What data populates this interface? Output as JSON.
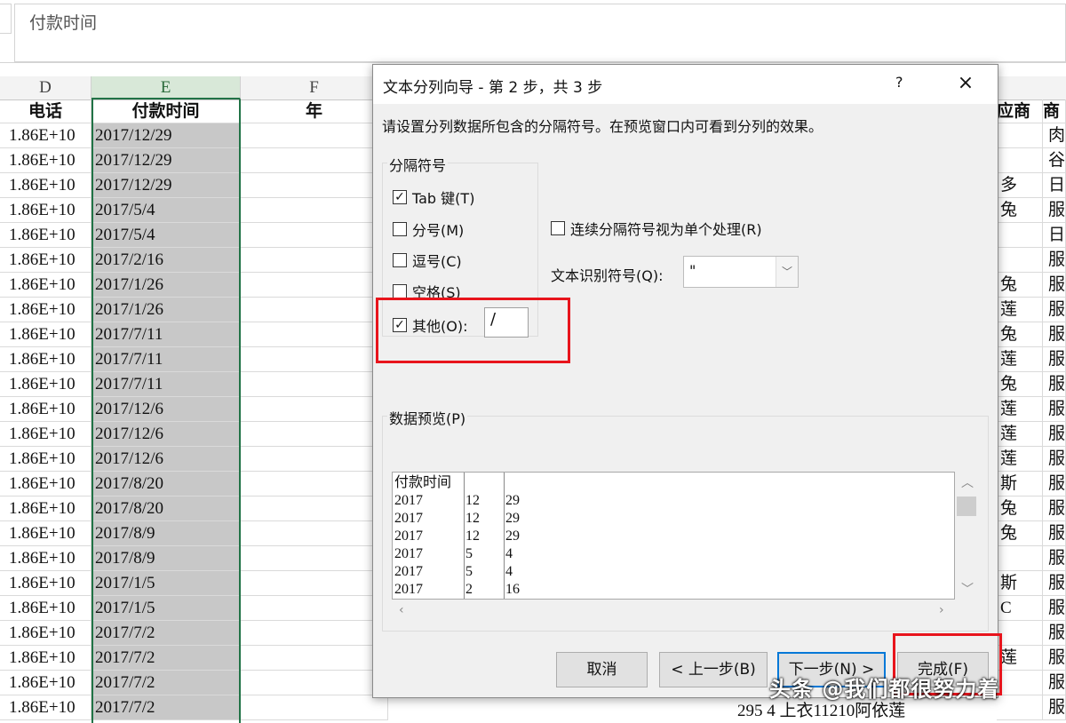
{
  "formula_bar": {
    "value": "付款时间"
  },
  "columns": [
    {
      "letter": "D",
      "header": "电话",
      "selected": false
    },
    {
      "letter": "E",
      "header": "付款时间",
      "selected": true
    },
    {
      "letter": "F",
      "header": "年",
      "selected": false
    }
  ],
  "rows": [
    {
      "phone": "1.86E+10",
      "date": "2017/12/29",
      "right1": "",
      "right2": "肉"
    },
    {
      "phone": "1.86E+10",
      "date": "2017/12/29",
      "right1": "",
      "right2": "谷"
    },
    {
      "phone": "1.86E+10",
      "date": "2017/12/29",
      "right1": "多",
      "right2": "日"
    },
    {
      "phone": "1.86E+10",
      "date": "2017/5/4",
      "right1": "兔",
      "right2": "服"
    },
    {
      "phone": "1.86E+10",
      "date": "2017/5/4",
      "right1": "",
      "right2": "日"
    },
    {
      "phone": "1.86E+10",
      "date": "2017/2/16",
      "right1": "",
      "right2": "服"
    },
    {
      "phone": "1.86E+10",
      "date": "2017/1/26",
      "right1": "兔",
      "right2": "服"
    },
    {
      "phone": "1.86E+10",
      "date": "2017/1/26",
      "right1": "莲",
      "right2": "服"
    },
    {
      "phone": "1.86E+10",
      "date": "2017/7/11",
      "right1": "兔",
      "right2": "服"
    },
    {
      "phone": "1.86E+10",
      "date": "2017/7/11",
      "right1": "莲",
      "right2": "服"
    },
    {
      "phone": "1.86E+10",
      "date": "2017/7/11",
      "right1": "兔",
      "right2": "服"
    },
    {
      "phone": "1.86E+10",
      "date": "2017/12/6",
      "right1": "莲",
      "right2": "服"
    },
    {
      "phone": "1.86E+10",
      "date": "2017/12/6",
      "right1": "莲",
      "right2": "服"
    },
    {
      "phone": "1.86E+10",
      "date": "2017/12/6",
      "right1": "莲",
      "right2": "服"
    },
    {
      "phone": "1.86E+10",
      "date": "2017/8/20",
      "right1": "斯",
      "right2": "服"
    },
    {
      "phone": "1.86E+10",
      "date": "2017/8/20",
      "right1": "兔",
      "right2": "服"
    },
    {
      "phone": "1.86E+10",
      "date": "2017/8/9",
      "right1": "兔",
      "right2": "服"
    },
    {
      "phone": "1.86E+10",
      "date": "2017/8/9",
      "right1": "",
      "right2": "服"
    },
    {
      "phone": "1.86E+10",
      "date": "2017/1/5",
      "right1": "斯",
      "right2": "服"
    },
    {
      "phone": "1.86E+10",
      "date": "2017/1/5",
      "right1": "C",
      "right2": "服"
    },
    {
      "phone": "1.86E+10",
      "date": "2017/7/2",
      "right1": "",
      "right2": "服"
    },
    {
      "phone": "1.86E+10",
      "date": "2017/7/2",
      "right1": "莲",
      "right2": "服"
    },
    {
      "phone": "1.86E+10",
      "date": "2017/7/2",
      "right1": "",
      "right2": "服"
    },
    {
      "phone": "1.86E+10",
      "date": "2017/7/2",
      "right1": "",
      "right2": "服"
    }
  ],
  "right_headers": {
    "h1": "应商",
    "h2": "商"
  },
  "bottom_row_partial": "295    4 上衣11210阿依莲",
  "dialog": {
    "title": "文本分列向导 - 第 2 步，共 3 步",
    "help": "?",
    "close": "×",
    "description": "请设置分列数据所包含的分隔符号。在预览窗口内可看到分列的效果。",
    "delimiters_group": "分隔符号",
    "tab": {
      "label": "Tab 键(T)",
      "checked": true
    },
    "semicolon": {
      "label": "分号(M)",
      "checked": false
    },
    "comma": {
      "label": "逗号(C)",
      "checked": false
    },
    "space": {
      "label": "空格(S)",
      "checked": false
    },
    "other": {
      "label": "其他(O):",
      "checked": true,
      "value": "/"
    },
    "consecutive": {
      "label": "连续分隔符号视为单个处理(R)",
      "checked": false
    },
    "qualifier_label": "文本识别符号(Q):",
    "qualifier_value": "\"",
    "preview_label": "数据预览(P)",
    "preview_rows": [
      [
        "付款时间",
        "",
        ""
      ],
      [
        "2017",
        "12",
        "29"
      ],
      [
        "2017",
        "12",
        "29"
      ],
      [
        "2017",
        "12",
        "29"
      ],
      [
        "2017",
        "5",
        "4"
      ],
      [
        "2017",
        "5",
        "4"
      ],
      [
        "2017",
        "2",
        "16"
      ]
    ],
    "buttons": {
      "cancel": "取消",
      "back": "< 上一步(B)",
      "next": "下一步(N) >",
      "finish": "完成(F)"
    }
  },
  "watermark": "头条 @我们都很努力着",
  "colors": {
    "selection_green": "#217346",
    "highlight_red": "#e8141c",
    "dialog_bg": "#f0f0f0"
  }
}
